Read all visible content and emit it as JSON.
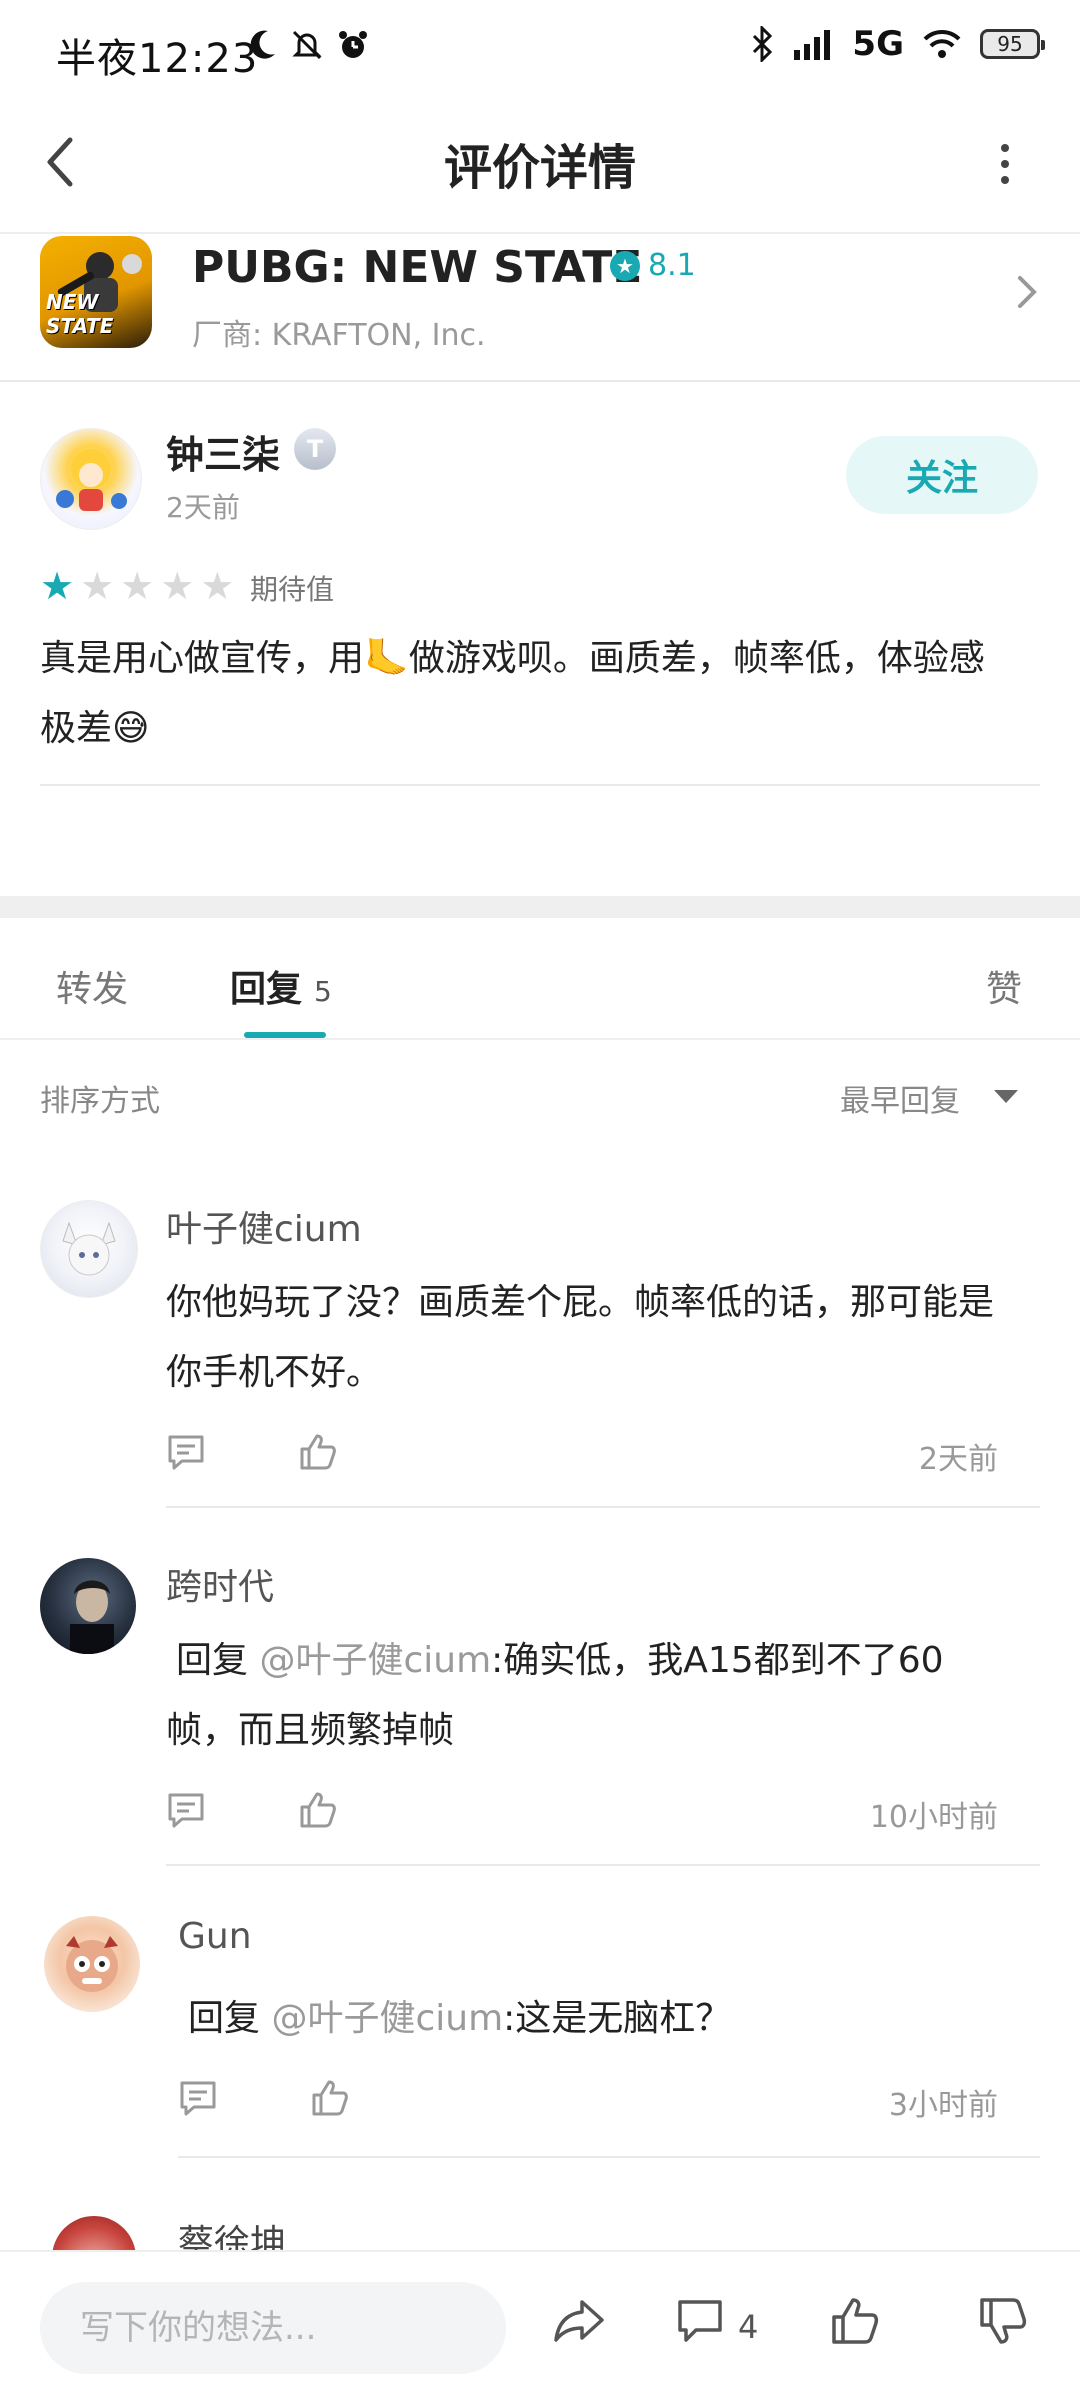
{
  "status_bar": {
    "time": "半夜12:23",
    "network": "5G",
    "battery": "95"
  },
  "nav": {
    "title": "评价详情"
  },
  "app": {
    "icon_text": "NEW STATE",
    "name": "PUBG: NEW STATE",
    "rating": "8.1",
    "vendor": "厂商: KRAFTON, Inc."
  },
  "review": {
    "author": "钟三柒",
    "level_badge": "T",
    "time": "2天前",
    "follow_label": "关注",
    "stars_filled": 1,
    "stars_total": 5,
    "stars_label": "期待值",
    "text_line1": "真是用心做宣传，用🦶做游戏呗。画质差，帧率低，体验感",
    "text_line2": "极差😅"
  },
  "tabs": {
    "forward": "转发",
    "reply": "回复",
    "reply_count": "5",
    "like": "赞"
  },
  "sort": {
    "label": "排序方式",
    "value": "最早回复"
  },
  "replies": [
    {
      "name": "叶子健cium",
      "line1": "你他妈玩了没？画质差个屁。帧率低的话，那可能是",
      "line2": "你手机不好。",
      "time": "2天前"
    },
    {
      "name": "跨时代",
      "prefix": "回复 ",
      "mention": "@叶子健cium",
      "line1_rest": ":确实低，我A15都到不了60",
      "line2": "帧，而且频繁掉帧",
      "time": "10小时前"
    },
    {
      "name": "Gun",
      "prefix": "回复 ",
      "mention": "@叶子健cium",
      "line1_rest": ":这是无脑杠？",
      "time": "3小时前"
    },
    {
      "name": "蔡徐坤"
    }
  ],
  "bottom_bar": {
    "input_placeholder": "写下你的想法...",
    "comment_count": "4"
  },
  "colors": {
    "accent": "#18a9b2",
    "follow_bg": "#e6f7f7",
    "muted_text": "#9a9a9a"
  }
}
